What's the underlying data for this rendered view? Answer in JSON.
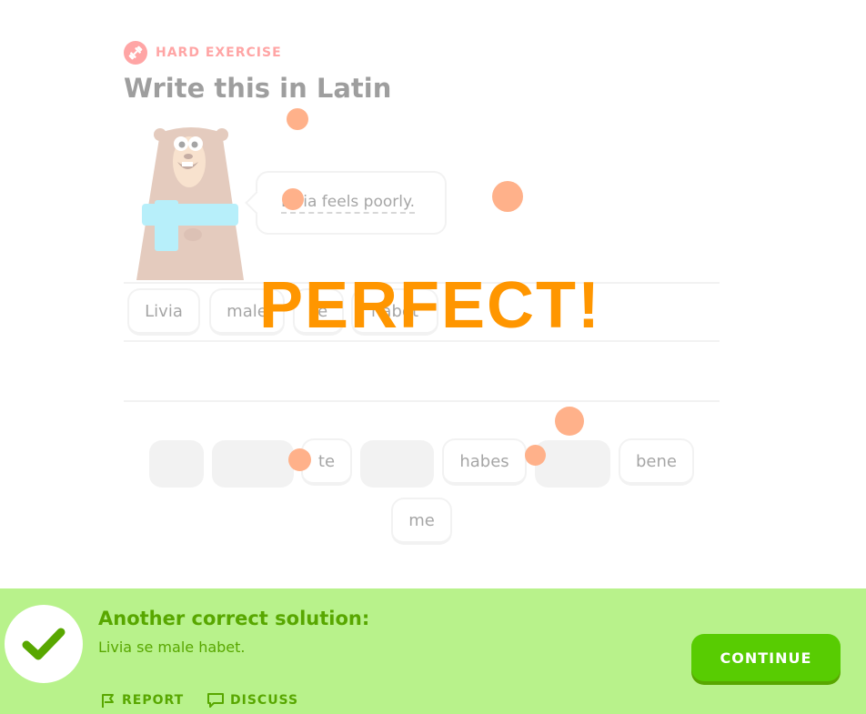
{
  "header": {
    "tag_label": "HARD EXERCISE",
    "title": "Write this in Latin"
  },
  "prompt": {
    "sentence": "Livia feels poorly."
  },
  "answer": {
    "chips": [
      "Livia",
      "male",
      "se",
      "habet"
    ]
  },
  "word_bank": {
    "words": [
      "",
      "",
      "te",
      "",
      "habes",
      "",
      "bene",
      "me"
    ]
  },
  "feedback": {
    "banner": "PERFECT!",
    "title": "Another correct solution:",
    "solution": "Livia se male habet.",
    "report_label": "REPORT",
    "discuss_label": "DISCUSS",
    "continue_label": "CONTINUE"
  },
  "colors": {
    "danger": "#ff4b4b",
    "orange": "#ff9600",
    "success_bg": "#b8f28b",
    "success_text": "#58a700",
    "success_button": "#58cc02"
  }
}
